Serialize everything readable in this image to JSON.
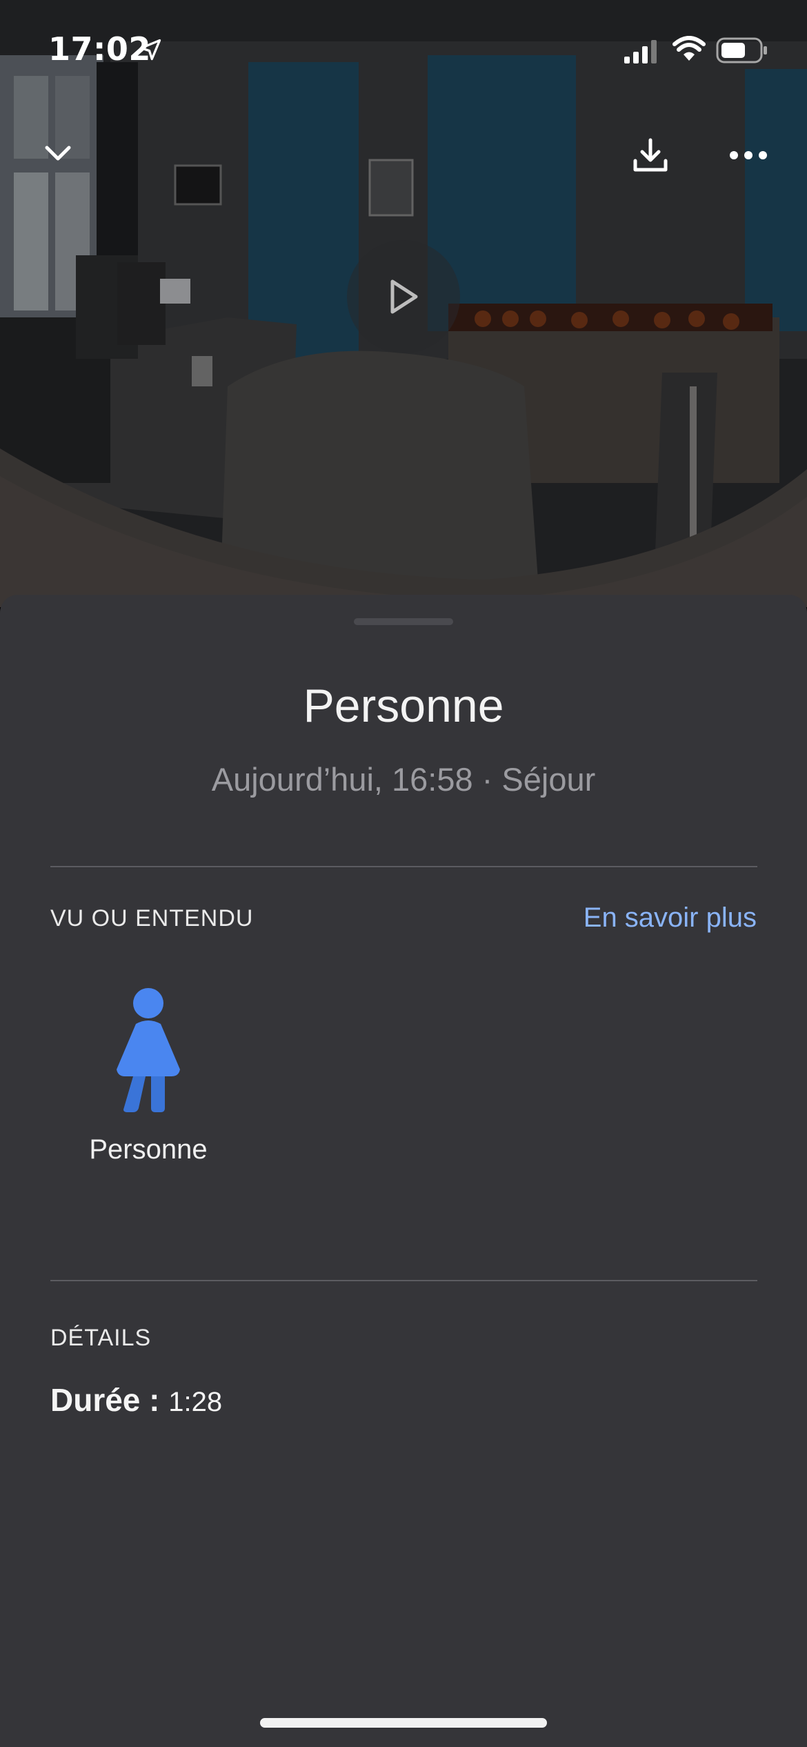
{
  "status_bar": {
    "time": "17:02",
    "icons": [
      "location-arrow-icon",
      "cellular-signal-icon",
      "wifi-icon",
      "battery-icon"
    ]
  },
  "video": {
    "toolbar": {
      "collapse_icon": "chevron-down-icon",
      "download_icon": "download-icon",
      "more_icon": "more-horizontal-icon"
    },
    "play_icon": "play-icon"
  },
  "event": {
    "title": "Personne",
    "subtitle": "Aujourd’hui, 16:58 · Séjour"
  },
  "seen_or_heard": {
    "label": "VU OU ENTENDU",
    "learn_more": "En savoir plus",
    "items": [
      {
        "icon": "person-icon",
        "label": "Personne"
      }
    ]
  },
  "details": {
    "label": "DÉTAILS",
    "duration_label": "Durée :",
    "duration_value": "1:28"
  },
  "colors": {
    "sheet_background": "#353539",
    "accent_link": "#8ab4f8",
    "person_icon": "#4a86f0"
  }
}
